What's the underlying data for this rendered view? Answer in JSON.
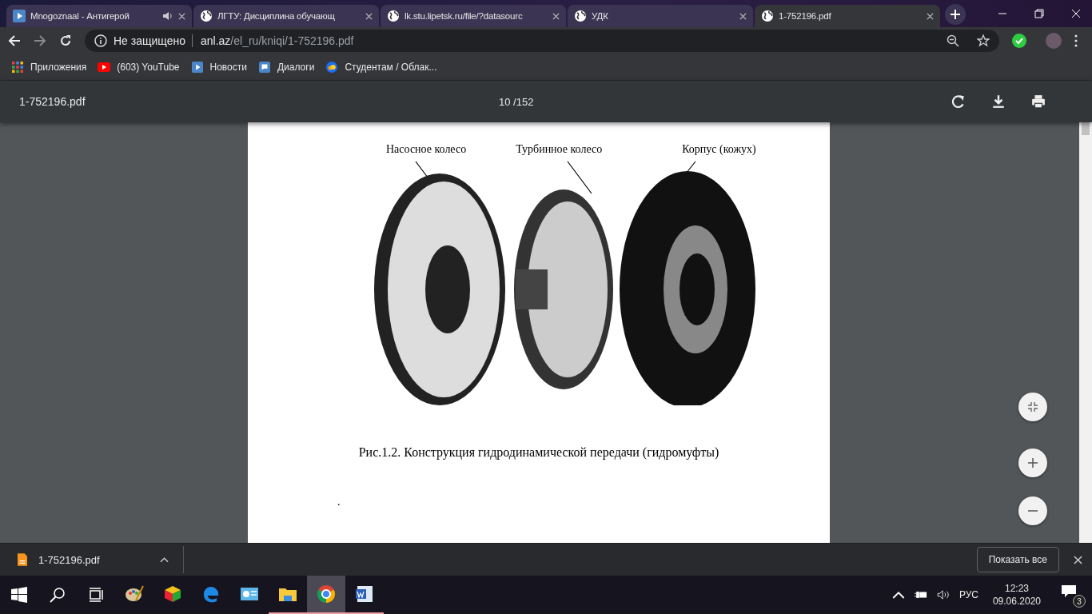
{
  "tabs": [
    {
      "title": "Mnogoznaal - Антигерой",
      "kind": "video",
      "audio": true,
      "selected": false
    },
    {
      "title": "ЛГТУ: Дисциплина обучающ",
      "kind": "web",
      "audio": false,
      "selected": false
    },
    {
      "title": "lk.stu.lipetsk.ru/file/?datasourc",
      "kind": "web",
      "audio": false,
      "selected": false
    },
    {
      "title": "УДК",
      "kind": "web",
      "audio": false,
      "selected": false
    },
    {
      "title": "1-752196.pdf",
      "kind": "web",
      "audio": false,
      "selected": true
    }
  ],
  "address": {
    "security": "Не защищено",
    "host": "anl.az",
    "path": "/el_ru/kniqi/1-752196.pdf"
  },
  "bookmarks": [
    {
      "label": "Приложения",
      "kind": "apps"
    },
    {
      "label": "(603) YouTube",
      "kind": "youtube"
    },
    {
      "label": "Новости",
      "kind": "video"
    },
    {
      "label": "Диалоги",
      "kind": "chat"
    },
    {
      "label": "Студентам / Облак...",
      "kind": "cloud"
    }
  ],
  "pdf": {
    "title": "1-752196.pdf",
    "page_indicator": "10 /152"
  },
  "figure": {
    "labels": [
      "Насосное колесо",
      "Турбинное колесо",
      "Корпус (кожух)"
    ],
    "caption": "Рис.1.2. Конструкция гидродинамической передачи (гидромуфты)",
    "page_mark": "."
  },
  "download": {
    "file": "1-752196.pdf",
    "show_all": "Показать все"
  },
  "taskbar": {
    "apps": [
      {
        "kind": "paint",
        "running": false,
        "selected": false
      },
      {
        "kind": "cube",
        "running": false,
        "selected": false
      },
      {
        "kind": "edge",
        "running": false,
        "selected": false
      },
      {
        "kind": "card",
        "running": false,
        "selected": false
      },
      {
        "kind": "folder",
        "running": true,
        "selected": false
      },
      {
        "kind": "chrome",
        "running": true,
        "selected": true
      },
      {
        "kind": "word",
        "running": true,
        "selected": false
      }
    ],
    "language": "РУС",
    "time": "12:23",
    "date": "09.06.2020",
    "notifications": "3"
  }
}
